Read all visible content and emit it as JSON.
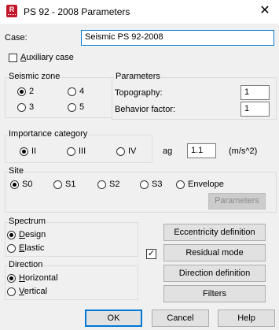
{
  "window": {
    "title": "PS 92 - 2008 Parameters",
    "close_symbol": "✕",
    "app_icon_letter": "R"
  },
  "case": {
    "label": "Case:",
    "value": "Seismic PS 92-2008"
  },
  "auxiliary_case": {
    "prefix": "",
    "label": "Auxiliary case",
    "checked": false
  },
  "seismic_zone": {
    "title": "Seismic zone",
    "options": [
      "2",
      "4",
      "3",
      "5"
    ],
    "selected": "2"
  },
  "parameters": {
    "title": "Parameters",
    "topography_label": "Topography:",
    "topography_value": "1",
    "behavior_label": "Behavior factor:",
    "behavior_value": "1"
  },
  "importance": {
    "title": "Importance category",
    "options": [
      "II",
      "III",
      "IV"
    ],
    "selected": "II",
    "ag_label": "ag",
    "ag_value": "1.1",
    "ag_unit": "(m/s^2)"
  },
  "site": {
    "title": "Site",
    "options": [
      "S0",
      "S1",
      "S2",
      "S3",
      "Envelope"
    ],
    "selected": "S0",
    "parameters_button": "Parameters"
  },
  "spectrum": {
    "title": "Spectrum",
    "options": [
      "Design",
      "Elastic"
    ],
    "selected": "Design"
  },
  "direction": {
    "title": "Direction",
    "options": [
      "Horizontal",
      "Vertical"
    ],
    "selected": "Horizontal"
  },
  "buttons": {
    "eccentricity": "Eccentricity definition",
    "residual": "Residual mode",
    "direction_def": "Direction definition",
    "filters": "Filters",
    "ok": "OK",
    "cancel": "Cancel",
    "help": "Help"
  },
  "residual_mode_checked": true,
  "check_mark": "✓"
}
